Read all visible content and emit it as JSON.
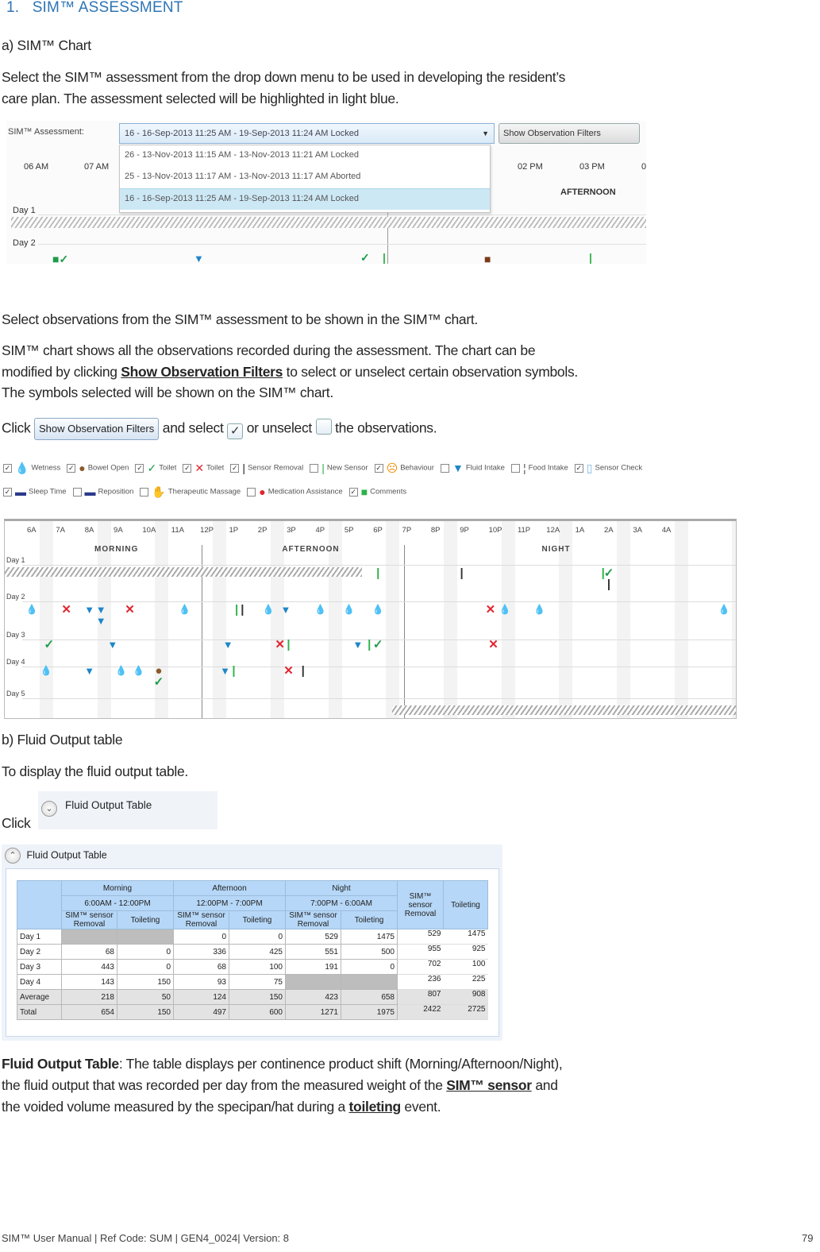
{
  "section": {
    "number": "1.",
    "title": "SIM™ ASSESSMENT"
  },
  "sim_chart": {
    "heading": "a) SIM™ Chart",
    "intro": "Select the SIM™ assessment from the drop down menu to be used in developing the resident’s care plan. The assessment selected will be highlighted in light blue.",
    "intro_line1": "Select the SIM™ assessment from the drop down menu to be used in developing the resident’s",
    "intro_line2": "care plan. The assessment selected will be highlighted in light blue."
  },
  "assessment_screenshot": {
    "label": "SIM™ Assessment:",
    "selected": "16 - 16-Sep-2013 11:25 AM - 19-Sep-2013 11:24 AM Locked",
    "filter_button": "Show Observation Filters",
    "options": [
      "26 - 13-Nov-2013 11:15 AM - 13-Nov-2013 11:21 AM Locked",
      "25 - 13-Nov-2013 11:17 AM - 13-Nov-2013 11:17 AM Aborted",
      "16 - 16-Sep-2013 11:25 AM - 19-Sep-2013 11:24 AM Locked"
    ],
    "selected_index": 2,
    "hours": [
      "06 AM",
      "07 AM",
      "02 PM",
      "03 PM",
      "0"
    ],
    "period": "AFTERNOON",
    "days": [
      "Day 1",
      "Day 2"
    ]
  },
  "observations": {
    "p1": "Select observations from the SIM™ assessment to be shown in the SIM™ chart.",
    "p2_a": "SIM™ chart shows all the observations recorded during the assessment. The chart can be",
    "p2_b": "modified by clicking ",
    "p2_link": "Show Observation Filters",
    "p2_c": " to select or unselect certain observation symbols.",
    "p2_d": "The symbols selected will be shown on the SIM™ chart.",
    "click_word": "Click",
    "button_label": "Show Observation Filters",
    "and_select": " and select ",
    "or_unselect": " or unselect ",
    "the_observations": " the observations.",
    "check_glyph": "✓"
  },
  "legend": {
    "row1": [
      {
        "label": "Wetness",
        "checked": true,
        "icon": "water-drop-icon",
        "glyph": "💧",
        "color": "#1976c8"
      },
      {
        "label": "Bowel Open",
        "checked": true,
        "icon": "bowel-circle-icon",
        "glyph": "●",
        "color": "#8b5a2b"
      },
      {
        "label": "Toilet",
        "checked": true,
        "icon": "check-mark-icon",
        "glyph": "✓",
        "color": "#1e9b4a"
      },
      {
        "label": "Toilet",
        "checked": true,
        "icon": "x-mark-icon",
        "glyph": "✕",
        "color": "#e0262f"
      },
      {
        "label": "Sensor Removal",
        "checked": true,
        "icon": "black-bar-icon",
        "glyph": "|",
        "color": "#222222"
      },
      {
        "label": "New Sensor",
        "checked": false,
        "icon": "green-bar-icon",
        "glyph": "|",
        "color": "#2fb24a"
      },
      {
        "label": "Behaviour",
        "checked": true,
        "icon": "behaviour-face-icon",
        "glyph": "☹",
        "color": "#f08a00"
      },
      {
        "label": "Fluid Intake",
        "checked": false,
        "icon": "cup-icon",
        "glyph": "▼",
        "color": "#1e86c8"
      },
      {
        "label": "Food Intake",
        "checked": false,
        "icon": "cutlery-icon",
        "glyph": "¦",
        "color": "#555555"
      },
      {
        "label": "Sensor Check",
        "checked": true,
        "icon": "sensor-check-icon",
        "glyph": "▯",
        "color": "#7ab8e0"
      }
    ],
    "row2": [
      {
        "label": "Sleep Time",
        "checked": true,
        "icon": "bed-icon",
        "glyph": "▬",
        "color": "#2a3a8c"
      },
      {
        "label": "Reposition",
        "checked": false,
        "icon": "reposition-bed-icon",
        "glyph": "▬",
        "color": "#2a3a8c"
      },
      {
        "label": "Therapeutic Massage",
        "checked": false,
        "icon": "hand-icon",
        "glyph": "✋",
        "color": "#7060a8"
      },
      {
        "label": "Medication Assistance",
        "checked": false,
        "icon": "pill-icon",
        "glyph": "●",
        "color": "#e0262f"
      },
      {
        "label": "Comments",
        "checked": true,
        "icon": "comment-bubble-icon",
        "glyph": "■",
        "color": "#2fb24a"
      }
    ]
  },
  "chart_data": {
    "type": "scatter",
    "title": "SIM™ chart",
    "x_ticks": [
      "6A",
      "7A",
      "8A",
      "9A",
      "10A",
      "11A",
      "12P",
      "1P",
      "2P",
      "3P",
      "4P",
      "5P",
      "6P",
      "7P",
      "8P",
      "9P",
      "10P",
      "11P",
      "12A",
      "1A",
      "2A",
      "3A",
      "4A"
    ],
    "periods": [
      {
        "name": "MORNING",
        "from_hour": 6,
        "to_hour": 12
      },
      {
        "name": "AFTERNOON",
        "from_hour": 12,
        "to_hour": 19
      },
      {
        "name": "NIGHT",
        "from_hour": 19,
        "to_hour": 30
      }
    ],
    "rows": [
      "Day 1",
      "Day 2",
      "Day 3",
      "Day 4",
      "Day 5"
    ],
    "no_data": [
      {
        "day": 1,
        "from_hour": 6,
        "to_hour": 16.9
      },
      {
        "day": 5,
        "from_hour": 18.5,
        "to_hour": 30
      }
    ],
    "markers": [
      {
        "day": 1,
        "hour": 18.0,
        "type": "new-sensor"
      },
      {
        "day": 1,
        "hour": 20.9,
        "type": "sensor-removal"
      },
      {
        "day": 1,
        "hour": 25.8,
        "type": "new-sensor"
      },
      {
        "day": 1,
        "hour": 26.0,
        "type": "toilet-yes"
      },
      {
        "day": 1,
        "hour": 26.0,
        "type": "sensor-removal",
        "stack": 1
      },
      {
        "day": 2,
        "hour": 6.0,
        "type": "wetness"
      },
      {
        "day": 2,
        "hour": 7.2,
        "type": "toilet-no"
      },
      {
        "day": 2,
        "hour": 8.0,
        "type": "fluid"
      },
      {
        "day": 2,
        "hour": 8.4,
        "type": "fluid"
      },
      {
        "day": 2,
        "hour": 8.4,
        "type": "fluid",
        "stack": 1
      },
      {
        "day": 2,
        "hour": 9.4,
        "type": "toilet-no"
      },
      {
        "day": 2,
        "hour": 11.3,
        "type": "wetness"
      },
      {
        "day": 2,
        "hour": 13.1,
        "type": "new-sensor"
      },
      {
        "day": 2,
        "hour": 13.3,
        "type": "sensor-removal"
      },
      {
        "day": 2,
        "hour": 14.2,
        "type": "wetness"
      },
      {
        "day": 2,
        "hour": 14.8,
        "type": "fluid"
      },
      {
        "day": 2,
        "hour": 16.0,
        "type": "wetness"
      },
      {
        "day": 2,
        "hour": 17.0,
        "type": "wetness"
      },
      {
        "day": 2,
        "hour": 18.0,
        "type": "wetness"
      },
      {
        "day": 2,
        "hour": 21.9,
        "type": "toilet-no"
      },
      {
        "day": 2,
        "hour": 22.4,
        "type": "wetness"
      },
      {
        "day": 2,
        "hour": 23.6,
        "type": "wetness"
      },
      {
        "day": 2,
        "hour": 30.0,
        "type": "wetness"
      },
      {
        "day": 3,
        "hour": 6.6,
        "type": "toilet-yes"
      },
      {
        "day": 3,
        "hour": 8.8,
        "type": "fluid"
      },
      {
        "day": 3,
        "hour": 12.8,
        "type": "fluid"
      },
      {
        "day": 3,
        "hour": 14.6,
        "type": "toilet-no"
      },
      {
        "day": 3,
        "hour": 14.9,
        "type": "new-sensor"
      },
      {
        "day": 3,
        "hour": 17.3,
        "type": "fluid"
      },
      {
        "day": 3,
        "hour": 17.7,
        "type": "new-sensor"
      },
      {
        "day": 3,
        "hour": 18.0,
        "type": "toilet-yes"
      },
      {
        "day": 3,
        "hour": 22.0,
        "type": "toilet-no"
      },
      {
        "day": 4,
        "hour": 6.5,
        "type": "wetness"
      },
      {
        "day": 4,
        "hour": 8.0,
        "type": "fluid"
      },
      {
        "day": 4,
        "hour": 9.1,
        "type": "wetness"
      },
      {
        "day": 4,
        "hour": 9.7,
        "type": "wetness"
      },
      {
        "day": 4,
        "hour": 10.4,
        "type": "bowel"
      },
      {
        "day": 4,
        "hour": 10.4,
        "type": "toilet-yes",
        "stack": 1
      },
      {
        "day": 4,
        "hour": 12.7,
        "type": "fluid"
      },
      {
        "day": 4,
        "hour": 13.0,
        "type": "new-sensor"
      },
      {
        "day": 4,
        "hour": 14.9,
        "type": "toilet-no"
      },
      {
        "day": 4,
        "hour": 15.4,
        "type": "sensor-removal"
      }
    ]
  },
  "fluid_output": {
    "heading": "b) Fluid Output table",
    "intro": "To display the fluid output table.",
    "click_word": "Click",
    "collapsed_label": "Fluid Output Table",
    "table_title": "Fluid Output Table",
    "shifts": [
      {
        "name": "Morning",
        "time": "6:00AM - 12:00PM"
      },
      {
        "name": "Afternoon",
        "time": "12:00PM - 7:00PM"
      },
      {
        "name": "Night",
        "time": "7:00PM - 6:00AM"
      }
    ],
    "sub_headers": [
      "SIM™ sensor Removal",
      "Toileting"
    ],
    "total_headers": [
      "SIM™ sensor Removal",
      "Toileting"
    ],
    "rows": [
      {
        "label": "Day 1",
        "values": [
          "",
          "",
          "0",
          "0",
          "529",
          "1475"
        ],
        "totals": [
          "529",
          "1475"
        ]
      },
      {
        "label": "Day 2",
        "values": [
          "68",
          "0",
          "336",
          "425",
          "551",
          "500"
        ],
        "totals": [
          "955",
          "925"
        ]
      },
      {
        "label": "Day 3",
        "values": [
          "443",
          "0",
          "68",
          "100",
          "191",
          "0"
        ],
        "totals": [
          "702",
          "100"
        ]
      },
      {
        "label": "Day 4",
        "values": [
          "143",
          "150",
          "93",
          "75",
          "",
          ""
        ],
        "totals": [
          "236",
          "225"
        ]
      },
      {
        "label": "Average",
        "values": [
          "218",
          "50",
          "124",
          "150",
          "423",
          "658"
        ],
        "totals": [
          "807",
          "908"
        ]
      },
      {
        "label": "Total",
        "values": [
          "654",
          "150",
          "497",
          "600",
          "1271",
          "1975"
        ],
        "totals": [
          "2422",
          "2725"
        ]
      }
    ],
    "desc_term": "Fluid Output Table",
    "desc_a": ": The table displays per continence product shift (Morning/Afternoon/Night),",
    "desc_b": "the fluid output that was recorded per day from the measured weight of the ",
    "desc_link1": "SIM™ sensor",
    "desc_c": " and",
    "desc_d": "the voided volume measured by the specipan/hat during a ",
    "desc_link2": "toileting",
    "desc_e": " event."
  },
  "footer": {
    "text": "SIM™ User Manual | Ref Code: SUM | GEN4_0024| Version: 8",
    "page": "79"
  }
}
